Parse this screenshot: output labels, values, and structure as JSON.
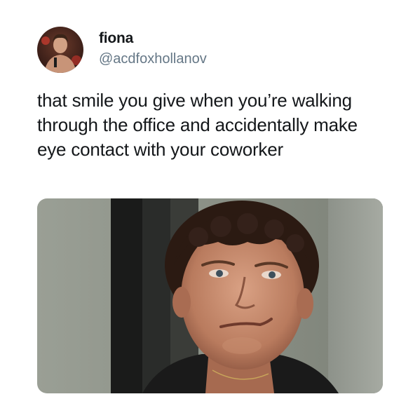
{
  "tweet": {
    "display_name": "fiona",
    "handle": "@acdfoxhollanov",
    "text": "that smile you give when you’re walking through the office and accidentally make eye contact with your coworker"
  },
  "icons": {
    "avatar": "profile-photo",
    "media": "smiling-man-photo"
  }
}
